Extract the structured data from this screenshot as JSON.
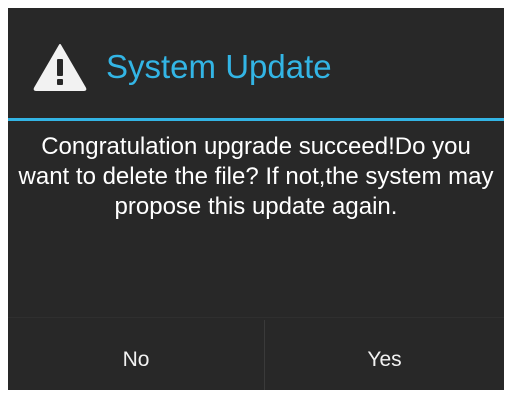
{
  "dialog": {
    "icon": "warning-triangle-icon",
    "title": "System Update",
    "message": "Congratulation upgrade succeed!Do you want to delete the file? If not,the system may propose this update again.",
    "buttons": {
      "no_label": "No",
      "yes_label": "Yes"
    }
  },
  "colors": {
    "background": "#282828",
    "accent": "#33b5e5",
    "text": "#ffffff"
  }
}
